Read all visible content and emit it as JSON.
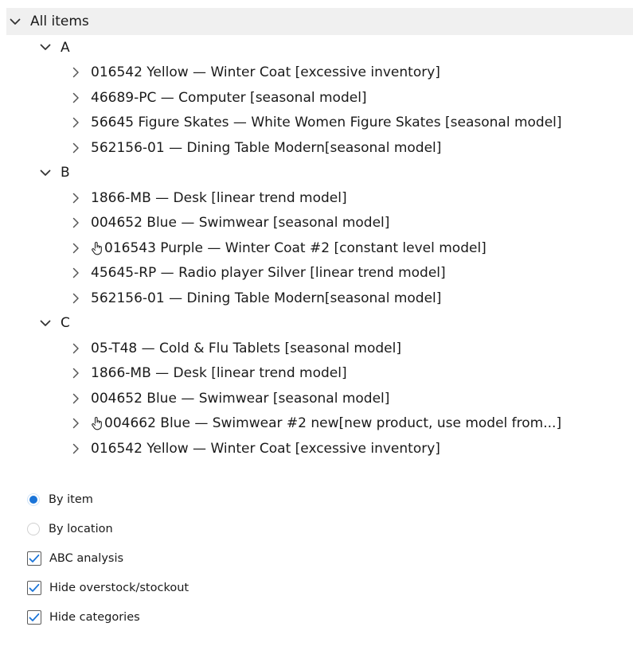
{
  "tree": {
    "root": {
      "label": "All items",
      "expanded": true
    },
    "categories": [
      {
        "label": "A",
        "expanded": true,
        "items": [
          {
            "label": "016542 Yellow — Winter Coat [excessive inventory]",
            "manual": false
          },
          {
            "label": "46689-PC — Computer [seasonal model]",
            "manual": false
          },
          {
            "label": "56645 Figure Skates — White Women Figure Skates [seasonal model]",
            "manual": false
          },
          {
            "label": "562156-01 — Dining Table Modern[seasonal model]",
            "manual": false
          }
        ]
      },
      {
        "label": "B",
        "expanded": true,
        "items": [
          {
            "label": "1866-MB — Desk [linear trend model]",
            "manual": false
          },
          {
            "label": "004652 Blue — Swimwear [seasonal model]",
            "manual": false
          },
          {
            "label": "016543 Purple — Winter Coat #2 [constant level model]",
            "manual": true
          },
          {
            "label": "45645-RP — Radio player Silver [linear trend model]",
            "manual": false
          },
          {
            "label": "562156-01 — Dining Table Modern[seasonal model]",
            "manual": false
          }
        ]
      },
      {
        "label": "C",
        "expanded": true,
        "items": [
          {
            "label": "05-T48 — Cold & Flu Tablets [seasonal model]",
            "manual": false
          },
          {
            "label": "1866-MB — Desk [linear trend model]",
            "manual": false
          },
          {
            "label": "004652 Blue — Swimwear [seasonal model]",
            "manual": false
          },
          {
            "label": "004662 Blue — Swimwear #2 new[new product, use model from...]",
            "manual": true
          },
          {
            "label": "016542 Yellow — Winter Coat [excessive inventory]",
            "manual": false
          }
        ]
      }
    ]
  },
  "options": {
    "group_by": {
      "selected": "by_item",
      "choices": [
        {
          "id": "by_item",
          "label": "By item"
        },
        {
          "id": "by_location",
          "label": "By location"
        }
      ]
    },
    "checkboxes": [
      {
        "id": "abc",
        "label": "ABC analysis",
        "checked": true
      },
      {
        "id": "hide_overstock",
        "label": "Hide overstock/stockout",
        "checked": true
      },
      {
        "id": "hide_categories",
        "label": "Hide categories",
        "checked": true
      }
    ]
  },
  "icons": {
    "expanded": "chevron-down-icon",
    "collapsed": "chevron-right-icon",
    "manual": "hand-pointer-icon"
  },
  "colors": {
    "accent": "#1a74d8",
    "root_highlight": "#f0f0f0",
    "text": "#1a1a1a"
  }
}
